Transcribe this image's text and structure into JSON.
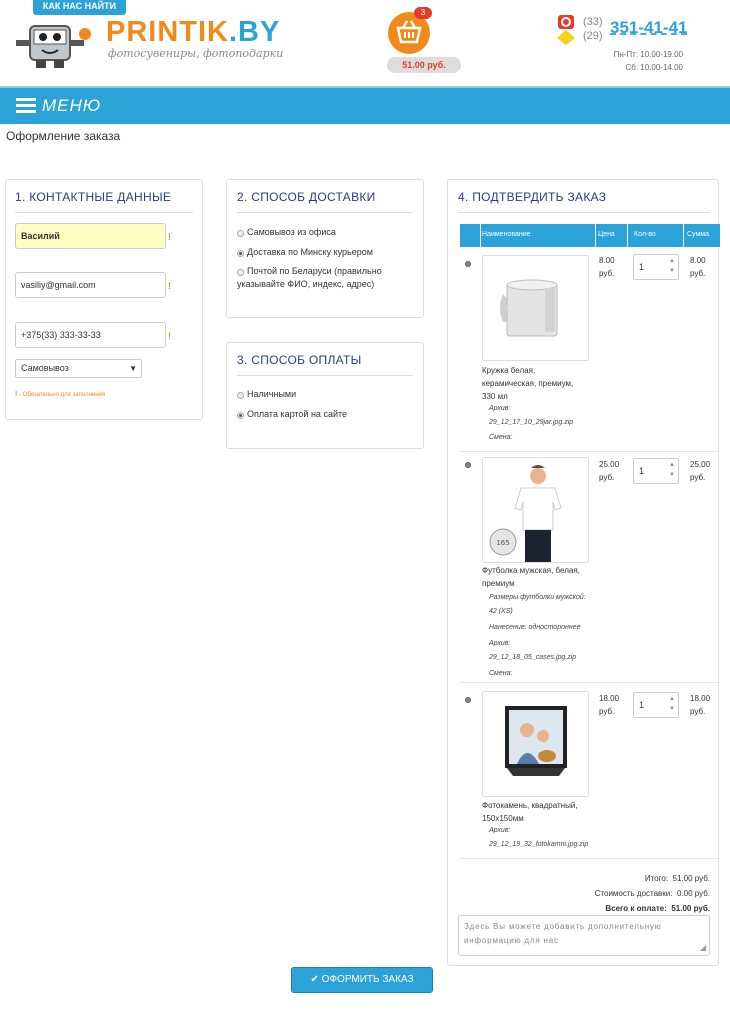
{
  "header": {
    "howto_label": "КАК НАС НАЙТИ",
    "logo_main": "PRINTIK",
    "logo_ext": ".BY",
    "logo_tagline": "фотосувениры, фотоподарки",
    "cart_count": "3",
    "cart_total": "51.00 руб.",
    "phone_code_1": "(33)",
    "phone_code_2": "(29)",
    "phone_number": "351-41-41",
    "hours_weekdays": "Пн-Пт: 10.00-19.00",
    "hours_saturday": "Сб: 10.00-14.00"
  },
  "menu": {
    "label": "МЕНЮ"
  },
  "page_title": "Оформление заказа",
  "contacts": {
    "title": "1. КОНТАКТНЫЕ ДАННЫЕ",
    "name_value": "Василий",
    "email_value": "vasiliy@gmail.com",
    "phone_value": "+375(33) 333-33-33",
    "delivery_select_value": "Самовывоз",
    "required_note": "- Обязательно для заполнения"
  },
  "delivery": {
    "title": "2. СПОСОБ ДОСТАВКИ",
    "options": [
      {
        "label": "Самовывоз из офиса"
      },
      {
        "label": "Доставка по Минску курьером"
      },
      {
        "label_line1": "Почтой по Беларуси (правильно",
        "label_line2": "указывайте ФИО, индекс, адрес)"
      }
    ],
    "selected_index": 1
  },
  "payment": {
    "title": "3. СПОСОБ ОПЛАТЫ",
    "options": [
      {
        "label": "Наличными"
      },
      {
        "label": "Оплата картой на сайте"
      }
    ],
    "selected_index": 1
  },
  "confirm": {
    "title": "4. ПОДТВЕРДИТЬ ЗАКАЗ",
    "columns": [
      "Наименование",
      "Цена",
      "Кол-во",
      "Сумма"
    ],
    "items": [
      {
        "name_line1": "Кружка белая,",
        "name_line2": "керамическая, премиум,",
        "name_line3": "330 мл",
        "archive_label": "Архив:",
        "archive_file": "29_12_17_10_29jar.jpg.zip",
        "comment_label": "Смена:",
        "price": "8.00",
        "price_unit": "руб.",
        "qty": "1",
        "sum": "8.00",
        "sum_unit": "руб."
      },
      {
        "name_line1": "Футболка мужская, белая,",
        "name_line2": "премиум",
        "size_label": "Размеры футболки мужской:",
        "size_value": "42 (XS)",
        "print_label": "Нанесение: одностороннее",
        "archive_label": "Архив:",
        "archive_file": "29_12_18_05_cases.jpg.zip",
        "comment_label": "Смена:",
        "price": "25.00",
        "price_unit": "руб.",
        "qty": "1",
        "sum": "25.00",
        "sum_unit": "руб."
      },
      {
        "name_line1": "Фотокамень, квадратный,",
        "name_line2": "150х150мм",
        "archive_label": "Архив:",
        "archive_file": "29_12_19_32_fotokamni.jpg.zip",
        "price": "18.00",
        "price_unit": "руб.",
        "qty": "1",
        "sum": "18.00",
        "sum_unit": "руб."
      }
    ],
    "total_label": "Итого:",
    "total_value": "51.00 руб.",
    "delivery_label": "Стоимость доставки:",
    "delivery_value": "0.00 руб.",
    "pay_label": "Всего к оплате:",
    "pay_value": "51.00 руб.",
    "comment_placeholder": "Здесь Вы можете добавить дополнительную информацию для нас"
  },
  "submit_label": "ОФОРМИТЬ ЗАКАЗ",
  "colors": {
    "accent": "#2ba3d9",
    "brand_orange": "#f08a1c",
    "title_blue": "#2a3b8f"
  }
}
